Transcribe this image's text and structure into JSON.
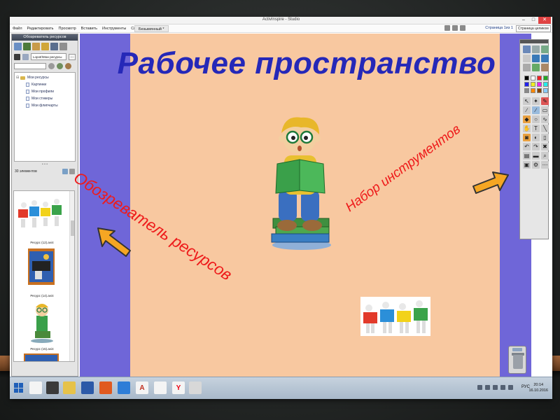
{
  "window": {
    "title": "ActivInspire - Studio",
    "controls": [
      "–",
      "□",
      "✕"
    ]
  },
  "menu": {
    "items": [
      "Файл",
      "Редактировать",
      "Просмотр",
      "Вставить",
      "Инструменты",
      "Справка"
    ]
  },
  "document_tab": "Безымянный *",
  "page_info": "Страница 1из 1",
  "zoom": "Страница целиком",
  "resource_browser": {
    "title": "Обозреватель ресурсов",
    "path": "Lopotr\\Мои ресурсы",
    "path_button": "...",
    "tree": [
      {
        "label": "Мои ресурсы",
        "level": 0
      },
      {
        "label": "Картинки",
        "level": 1
      },
      {
        "label": "Мои профили",
        "level": 1
      },
      {
        "label": "Мои стикеры",
        "level": 1
      },
      {
        "label": "Мои флипчарты",
        "level": 1
      }
    ],
    "item_count": "30 элементов",
    "thumbnails": [
      {
        "caption": "Ресурс (12).avi4"
      },
      {
        "caption": "Ресурс (14).avi4"
      },
      {
        "caption": "Ресурс (15).avi4"
      }
    ]
  },
  "canvas": {
    "title": "Рабочее пространство",
    "label_browser": "Обозреватель ресурсов",
    "label_tools": "Набор инструментов"
  },
  "toolbox": {
    "text_tool_glyph": "T"
  },
  "taskbar": {
    "language": "РУС",
    "time": "20:14",
    "date": "16.10.2016",
    "yandex_glyph": "Y",
    "pdf_glyph": "A"
  },
  "colors": {
    "canvas_bg": "#f8c8a0",
    "side_purple": "#6f66d8",
    "title_blue": "#2528b8",
    "label_red": "#ee1b1b",
    "arrow_fill": "#f5a623"
  }
}
